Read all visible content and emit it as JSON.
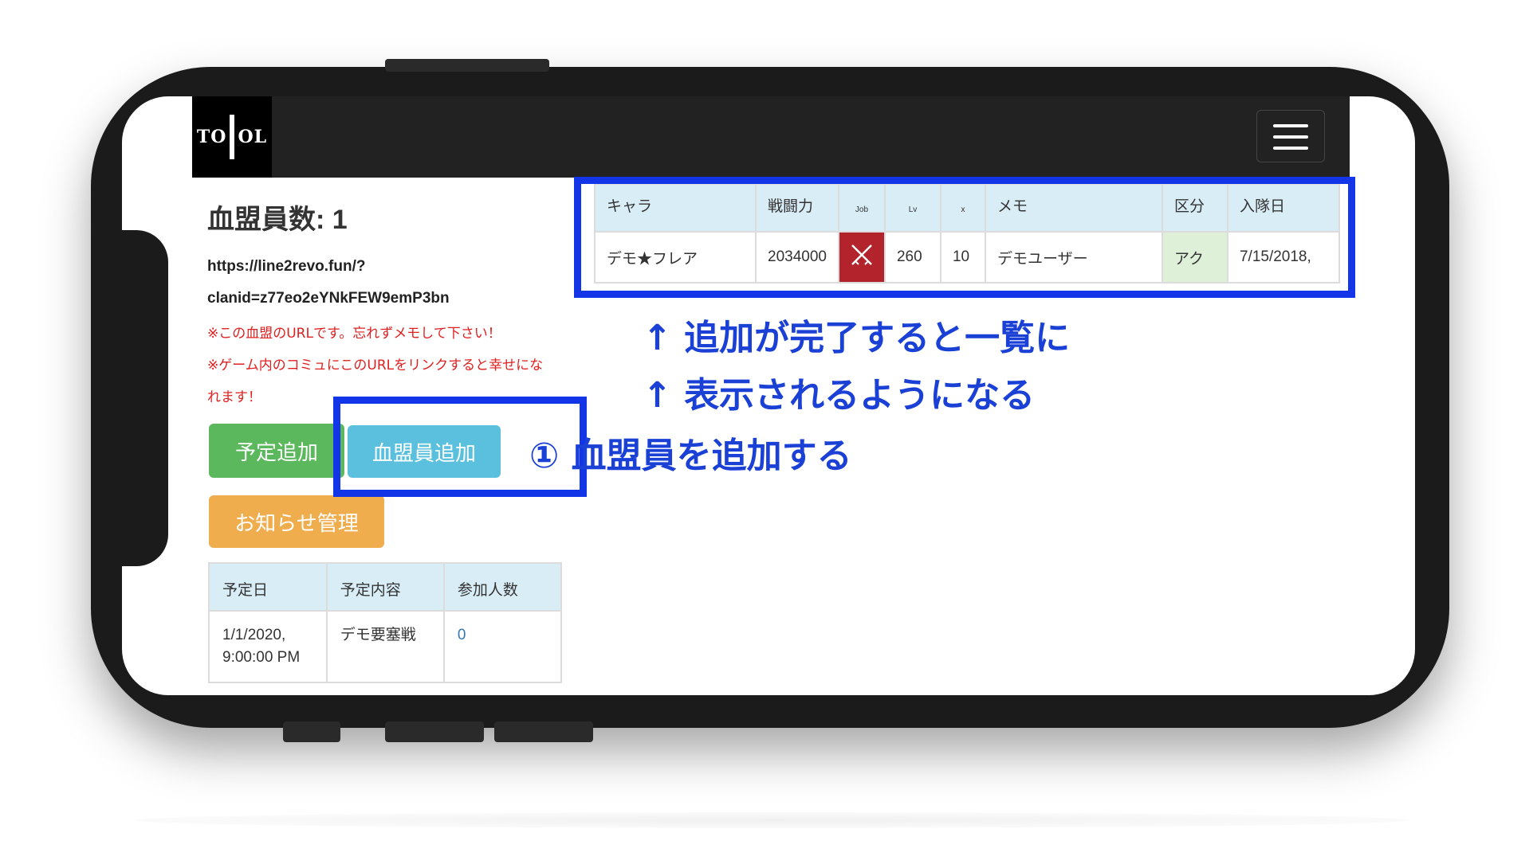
{
  "logo": {
    "left": "TO",
    "right": "OL"
  },
  "page": {
    "title": "血盟員数: 1",
    "url_line1": "https://line2revo.fun/?",
    "url_line2": "clanid=z77eo2eYNkFEW9emP3bn",
    "note1": "※この血盟のURLです。忘れずメモして下さい！",
    "note2": "※ゲーム内のコミュにこのURLをリンクすると幸せにな",
    "note3": "れます！"
  },
  "buttons": {
    "add_schedule": "予定追加",
    "add_member": "血盟員追加",
    "notice_admin": "お知らせ管理"
  },
  "colors": {
    "green": "#5cb85c",
    "info": "#5bc0de",
    "warning": "#f0ad4e",
    "annotation": "#1335e8"
  },
  "schedule_table": {
    "headers": [
      "予定日",
      "予定内容",
      "参加人数"
    ],
    "rows": [
      {
        "date_line1": "1/1/2020,",
        "date_line2": "9:00:00 PM",
        "content": "デモ要塞戦",
        "count": "0"
      }
    ]
  },
  "member_table": {
    "headers": [
      "キャラ",
      "戦闘力",
      "Job",
      "Lv",
      "メモ",
      "区分",
      "入隊日"
    ],
    "x_header": "x",
    "rows": [
      {
        "name": "デモ★フレア",
        "power": "2034000",
        "job_icon": "crossed-swords-icon",
        "lv": "260",
        "x": "10",
        "memo": "デモユーザー",
        "kubun": "アク",
        "joined": "7/15/2018,"
      }
    ]
  },
  "annotations": {
    "line1": "↑ 追加が完了すると一覧に",
    "line2": "↑ 表示されるようになる",
    "step1": "① 血盟員を追加する"
  }
}
